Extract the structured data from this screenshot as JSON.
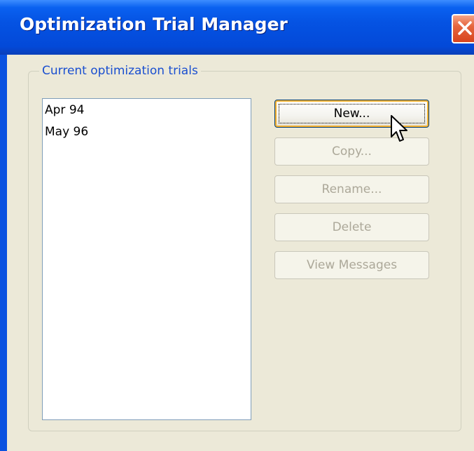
{
  "window": {
    "title": "Optimization Trial Manager",
    "close_icon": "close-icon"
  },
  "group": {
    "legend": "Current optimization trials"
  },
  "trials": {
    "items": [
      "Apr 94",
      "May 96"
    ]
  },
  "buttons": {
    "new_label": "New...",
    "copy_label": "Copy...",
    "rename_label": "Rename...",
    "delete_label": "Delete",
    "view_messages_label": "View Messages"
  },
  "colors": {
    "titlebar": "#0553e3",
    "dialog_background": "#ece9d8",
    "legend_text": "#1a4fd0",
    "close_button": "#e5663f",
    "focus_glow": "#f8b330",
    "disabled_text": "#aca899"
  }
}
